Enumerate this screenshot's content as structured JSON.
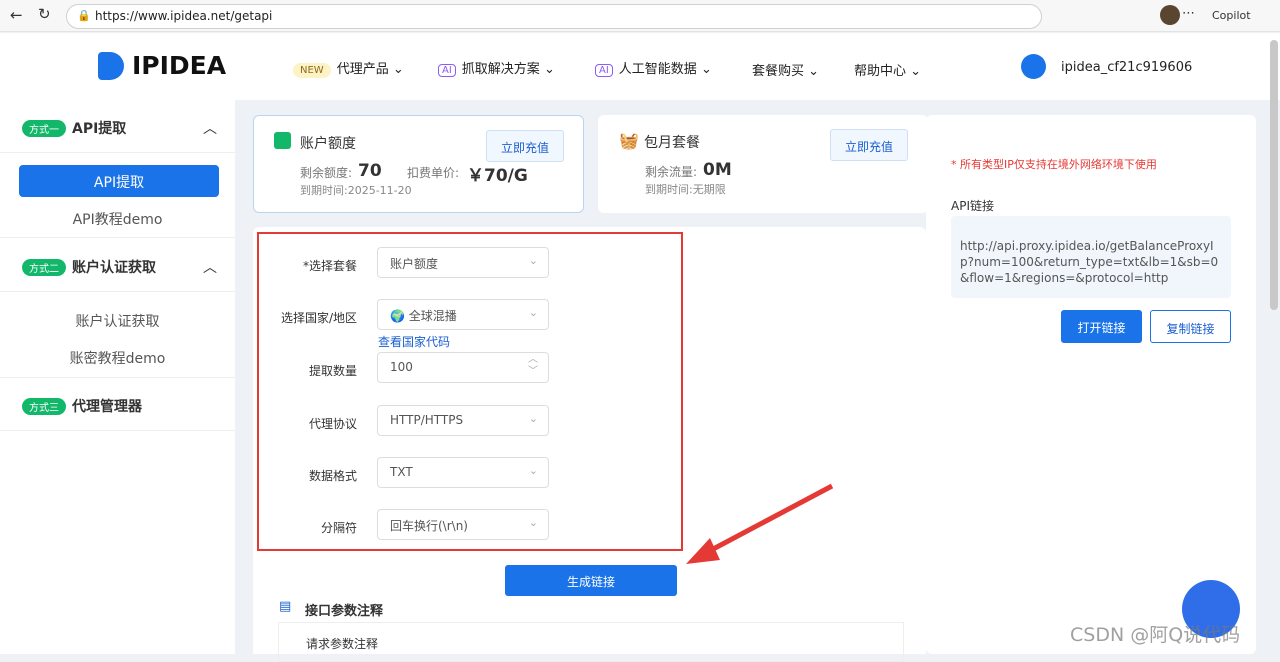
{
  "browser": {
    "url": "https://www.ipidea.net/getapi",
    "copilot": "Copilot"
  },
  "header": {
    "logo": "IPIDEA",
    "nav": [
      {
        "badge": "NEW",
        "label": "代理产品"
      },
      {
        "badge": "AI",
        "label": "抓取解决方案"
      },
      {
        "badge": "AI",
        "label": "人工智能数据"
      },
      {
        "label": "套餐购买"
      },
      {
        "label": "帮助中心"
      }
    ],
    "username": "ipidea_cf21c919606"
  },
  "sidebar": {
    "groups": [
      {
        "badge": "方式一",
        "title": "API提取",
        "items": [
          "API提取",
          "API教程demo"
        ]
      },
      {
        "badge": "方式二",
        "title": "账户认证获取",
        "items": [
          "账户认证获取",
          "账密教程demo"
        ]
      },
      {
        "badge": "方式三",
        "title": "代理管理器",
        "items": []
      }
    ]
  },
  "account": {
    "title": "账户额度",
    "recharge": "立即充值",
    "remain_label": "剩余额度:",
    "remain": "70",
    "price_label": "扣费单价:",
    "price": "￥70/G",
    "expire": "到期时间:2025-11-20"
  },
  "monthly": {
    "title": "包月套餐",
    "recharge": "立即充值",
    "remain_label": "剩余流量:",
    "remain": "0M",
    "expire": "到期时间:无期限"
  },
  "form": {
    "fields": [
      {
        "label": "*选择套餐",
        "value": "账户额度"
      },
      {
        "label": "选择国家/地区",
        "value": "全球混播"
      },
      {
        "label": "提取数量",
        "value": "100"
      },
      {
        "label": "代理协议",
        "value": "HTTP/HTTPS"
      },
      {
        "label": "数据格式",
        "value": "TXT"
      },
      {
        "label": "分隔符",
        "value": "回车换行(\\r\\n)"
      }
    ],
    "country_link": "查看国家代码",
    "generate": "生成链接"
  },
  "params": {
    "title": "接口参数注释",
    "sub": "请求参数注释"
  },
  "right": {
    "warning": "* 所有类型IP仅支持在境外网络环境下使用",
    "api_label": "API链接",
    "api_url": "http://api.proxy.ipidea.io/getBalanceProxyIp?num=100&return_type=txt&lb=1&sb=0&flow=1&regions=&protocol=http",
    "open": "打开链接",
    "copy": "复制链接"
  },
  "watermark": "CSDN @阿Q说代码",
  "colors": {
    "primary": "#1a73e8",
    "highlight": "#e53935",
    "green": "#12b76a"
  }
}
